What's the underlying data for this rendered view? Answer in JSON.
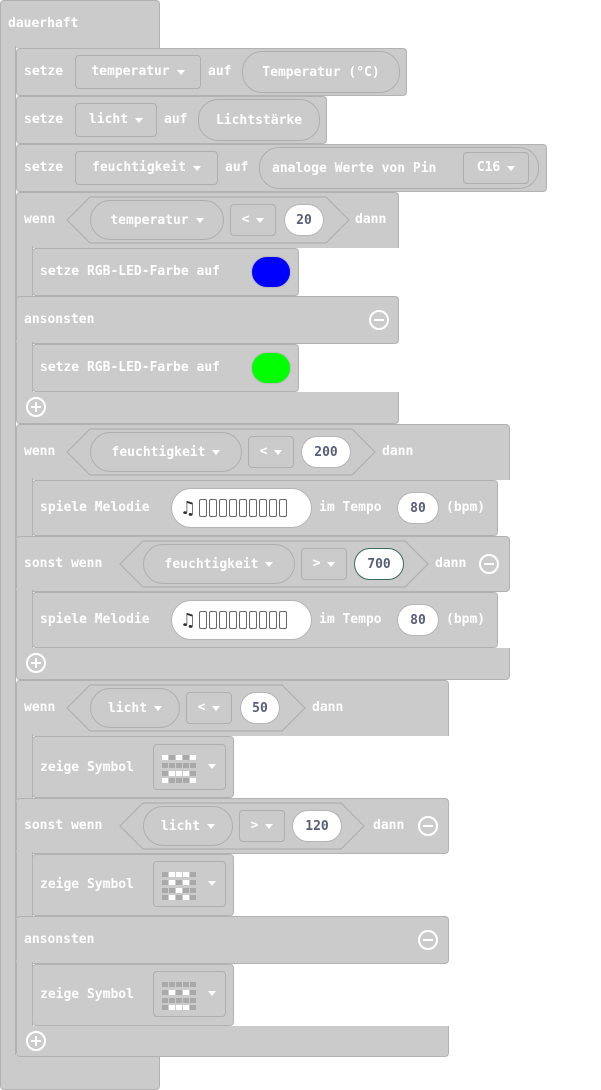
{
  "forever": {
    "label": "dauerhaft"
  },
  "set_word": "setze",
  "to_word": "auf",
  "set_blocks": [
    {
      "variable": "temperatur",
      "value": "Temperatur (°C)"
    },
    {
      "variable": "licht",
      "value": "Lichtstärke"
    },
    {
      "variable": "feuchtigkeit",
      "value": "analoge Werte von Pin",
      "pin": "C16"
    }
  ],
  "keywords": {
    "if": "wenn",
    "then": "dann",
    "else": "ansonsten",
    "else_if": "sonst wenn"
  },
  "if1": {
    "variable": "temperatur",
    "operator": "<",
    "value": "20",
    "then_action": "setze RGB-LED-Farbe auf",
    "then_color": "#0000ff",
    "else_action": "setze RGB-LED-Farbe auf",
    "else_color": "#00ff00"
  },
  "if2": {
    "variable": "feuchtigkeit",
    "operator": "<",
    "value": "200",
    "then_action": "spiele Melodie",
    "tempo_label": "im Tempo",
    "tempo": "80",
    "unit": "(bpm)",
    "elseif_variable": "feuchtigkeit",
    "elseif_operator": ">",
    "elseif_value": "700",
    "elseif_action": "spiele Melodie",
    "elseif_tempo": "80"
  },
  "if3": {
    "variable": "licht",
    "operator": "<",
    "value": "50",
    "then_action": "zeige Symbol",
    "elseif_variable": "licht",
    "elseif_operator": ">",
    "elseif_value": "120",
    "elseif_action": "zeige Symbol",
    "else_action": "zeige Symbol"
  },
  "colors": {
    "block": "#cbcbcb",
    "border": "#b2b2b2",
    "text": "#ffffff",
    "number_text": "#575e75"
  },
  "icons": [
    "music-note-icon",
    "chevron-down-icon",
    "minus-circle-icon",
    "plus-circle-icon",
    "led-matrix-icon"
  ]
}
